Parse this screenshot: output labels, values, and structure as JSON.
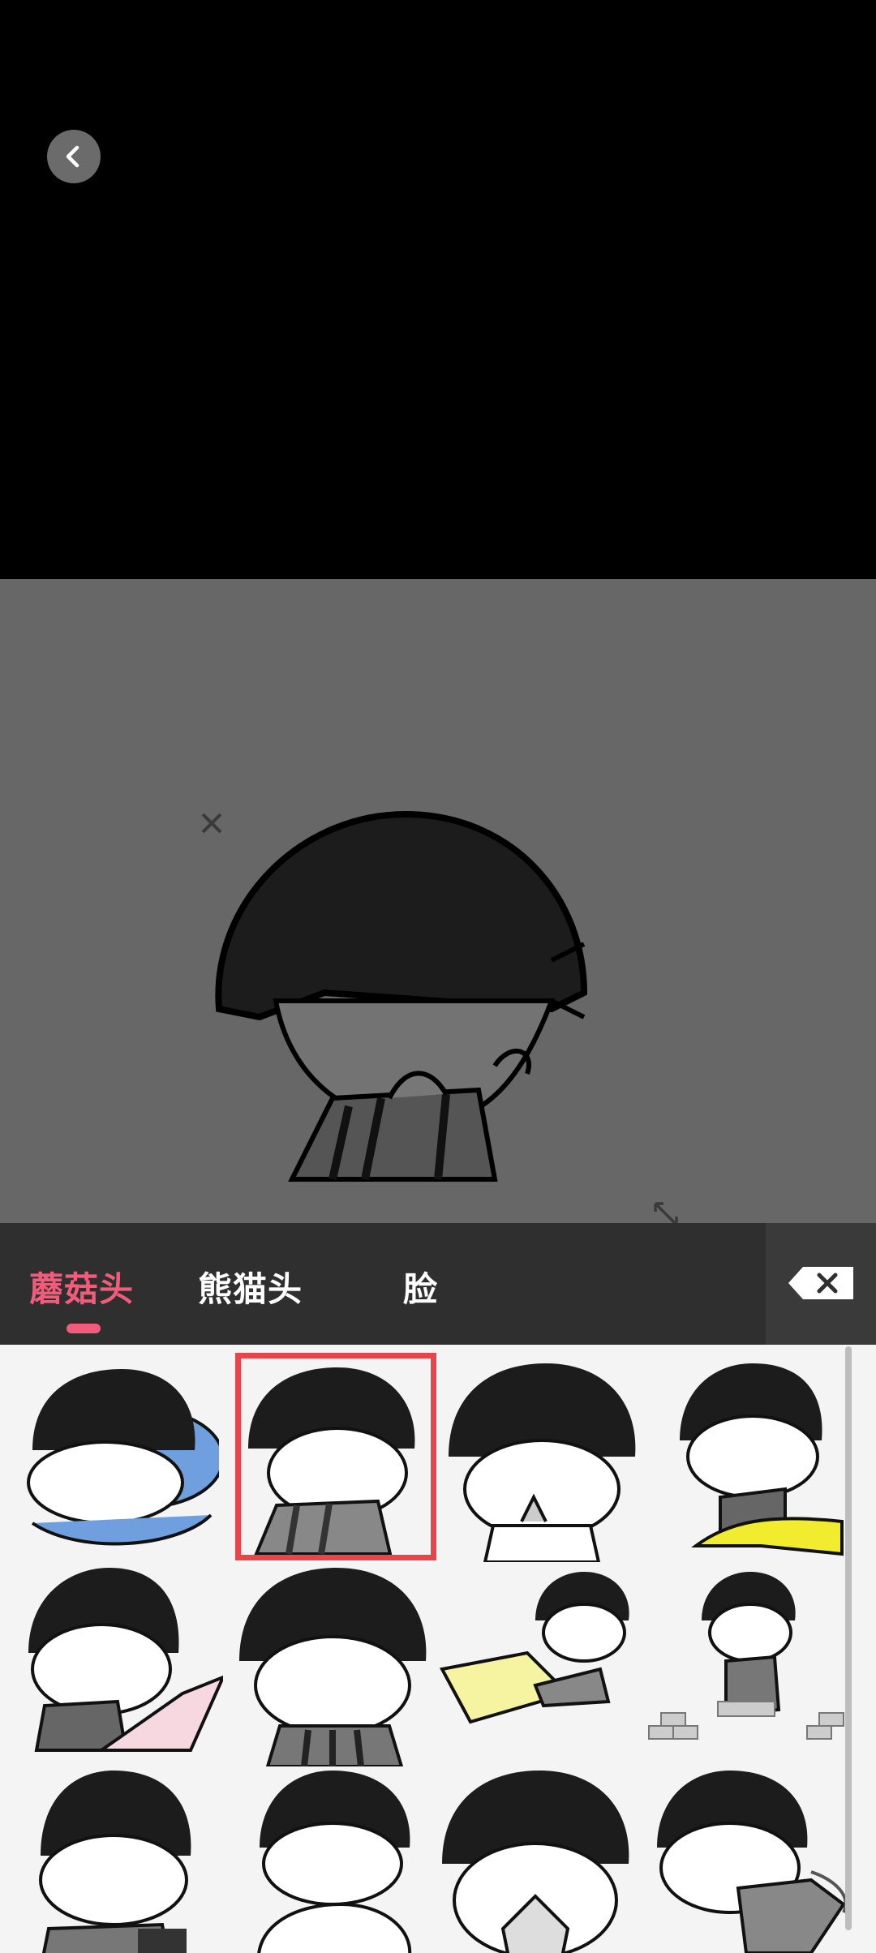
{
  "toolbar": {
    "back_icon": "chevron-left-icon"
  },
  "tabs": [
    {
      "label": "蘑菇头",
      "active": true
    },
    {
      "label": "熊猫头",
      "active": false
    },
    {
      "label": "脸",
      "active": false
    }
  ],
  "colors": {
    "accent": "#f25c7a",
    "tabbar_bg": "#2f2f2f",
    "canvas_bg": "#676767",
    "grid_bg": "#f4f4f4",
    "selection_border": "#e8454a"
  },
  "icons": {
    "delete": "backspace-icon",
    "close": "close-icon",
    "resize": "resize-icon"
  }
}
